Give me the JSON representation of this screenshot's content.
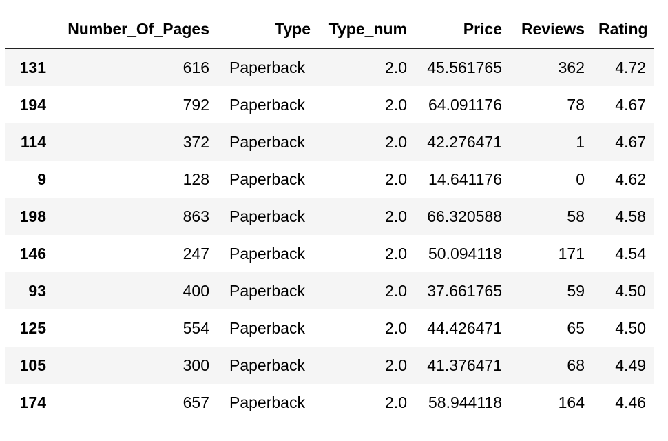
{
  "table": {
    "columns": [
      "",
      "Number_Of_Pages",
      "Type",
      "Type_num",
      "Price",
      "Reviews",
      "Rating"
    ],
    "rows": [
      {
        "index": "131",
        "pages": "616",
        "type": "Paperback",
        "type_num": "2.0",
        "price": "45.561765",
        "reviews": "362",
        "rating": "4.72"
      },
      {
        "index": "194",
        "pages": "792",
        "type": "Paperback",
        "type_num": "2.0",
        "price": "64.091176",
        "reviews": "78",
        "rating": "4.67"
      },
      {
        "index": "114",
        "pages": "372",
        "type": "Paperback",
        "type_num": "2.0",
        "price": "42.276471",
        "reviews": "1",
        "rating": "4.67"
      },
      {
        "index": "9",
        "pages": "128",
        "type": "Paperback",
        "type_num": "2.0",
        "price": "14.641176",
        "reviews": "0",
        "rating": "4.62"
      },
      {
        "index": "198",
        "pages": "863",
        "type": "Paperback",
        "type_num": "2.0",
        "price": "66.320588",
        "reviews": "58",
        "rating": "4.58"
      },
      {
        "index": "146",
        "pages": "247",
        "type": "Paperback",
        "type_num": "2.0",
        "price": "50.094118",
        "reviews": "171",
        "rating": "4.54"
      },
      {
        "index": "93",
        "pages": "400",
        "type": "Paperback",
        "type_num": "2.0",
        "price": "37.661765",
        "reviews": "59",
        "rating": "4.50"
      },
      {
        "index": "125",
        "pages": "554",
        "type": "Paperback",
        "type_num": "2.0",
        "price": "44.426471",
        "reviews": "65",
        "rating": "4.50"
      },
      {
        "index": "105",
        "pages": "300",
        "type": "Paperback",
        "type_num": "2.0",
        "price": "41.376471",
        "reviews": "68",
        "rating": "4.49"
      },
      {
        "index": "174",
        "pages": "657",
        "type": "Paperback",
        "type_num": "2.0",
        "price": "58.944118",
        "reviews": "164",
        "rating": "4.46"
      }
    ]
  }
}
